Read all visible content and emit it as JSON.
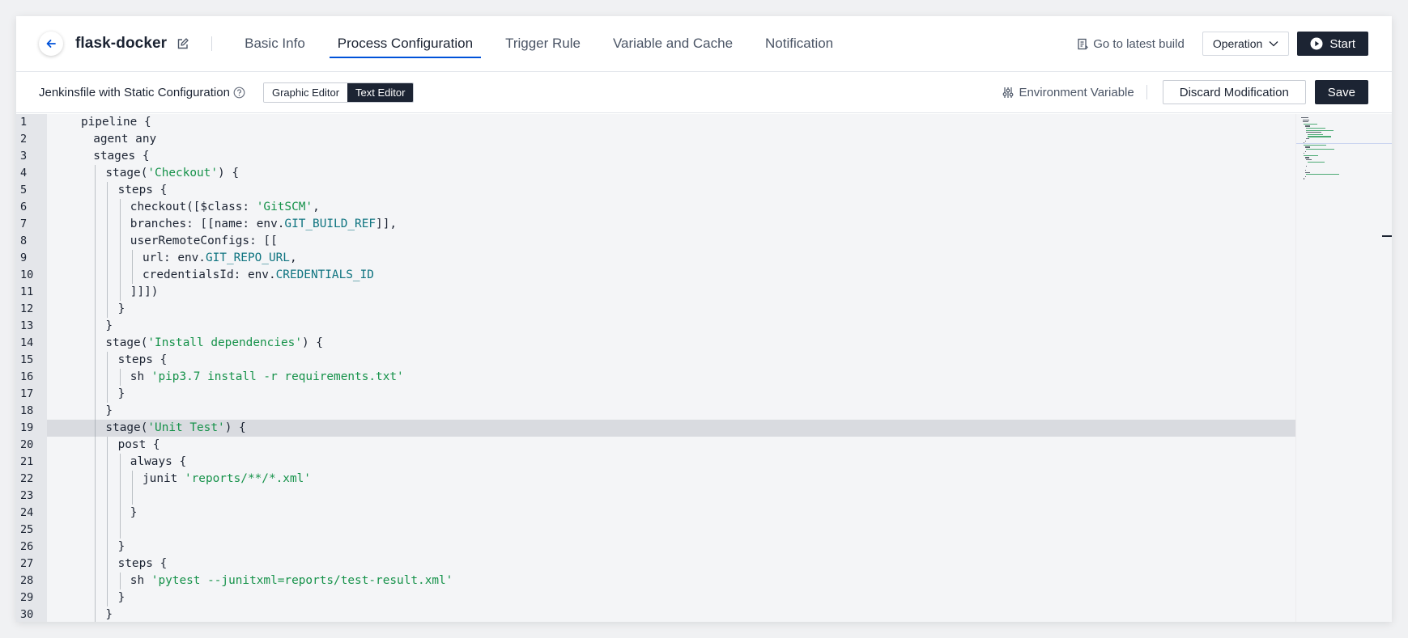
{
  "header": {
    "project_name": "flask-docker",
    "tabs": [
      {
        "label": "Basic Info",
        "active": false
      },
      {
        "label": "Process Configuration",
        "active": true
      },
      {
        "label": "Trigger Rule",
        "active": false
      },
      {
        "label": "Variable and Cache",
        "active": false
      },
      {
        "label": "Notification",
        "active": false
      }
    ],
    "latest_build_label": "Go to latest build",
    "operation_label": "Operation",
    "start_label": "Start"
  },
  "toolbar": {
    "config_label": "Jenkinsfile with Static Configuration",
    "graphic_editor_label": "Graphic Editor",
    "text_editor_label": "Text Editor",
    "env_variable_label": "Environment Variable",
    "discard_label": "Discard Modification",
    "save_label": "Save"
  },
  "editor": {
    "highlighted_line": 19,
    "lines": [
      {
        "n": "1",
        "indent": 0,
        "tokens": [
          [
            "t",
            "pipeline {"
          ]
        ]
      },
      {
        "n": "2",
        "indent": 1,
        "tokens": [
          [
            "t",
            "agent any"
          ]
        ]
      },
      {
        "n": "3",
        "indent": 1,
        "tokens": [
          [
            "t",
            "stages {"
          ]
        ]
      },
      {
        "n": "4",
        "indent": 2,
        "tokens": [
          [
            "t",
            "stage("
          ],
          [
            "s",
            "'Checkout'"
          ],
          [
            "t",
            ") {"
          ]
        ]
      },
      {
        "n": "5",
        "indent": 3,
        "tokens": [
          [
            "t",
            "steps {"
          ]
        ]
      },
      {
        "n": "6",
        "indent": 4,
        "tokens": [
          [
            "t",
            "checkout([$class: "
          ],
          [
            "s",
            "'GitSCM'"
          ],
          [
            "t",
            ","
          ]
        ]
      },
      {
        "n": "7",
        "indent": 4,
        "tokens": [
          [
            "t",
            "branches: [[name: env."
          ],
          [
            "p",
            "GIT_BUILD_REF"
          ],
          [
            "t",
            "]],"
          ]
        ]
      },
      {
        "n": "8",
        "indent": 4,
        "tokens": [
          [
            "t",
            "userRemoteConfigs: [["
          ]
        ]
      },
      {
        "n": "9",
        "indent": 5,
        "tokens": [
          [
            "t",
            "url: env."
          ],
          [
            "p",
            "GIT_REPO_URL"
          ],
          [
            "t",
            ","
          ]
        ]
      },
      {
        "n": "10",
        "indent": 5,
        "tokens": [
          [
            "t",
            "credentialsId: env."
          ],
          [
            "p",
            "CREDENTIALS_ID"
          ]
        ]
      },
      {
        "n": "11",
        "indent": 4,
        "tokens": [
          [
            "t",
            "]]])"
          ]
        ]
      },
      {
        "n": "12",
        "indent": 3,
        "tokens": [
          [
            "t",
            "}"
          ]
        ]
      },
      {
        "n": "13",
        "indent": 2,
        "tokens": [
          [
            "t",
            "}"
          ]
        ]
      },
      {
        "n": "14",
        "indent": 2,
        "tokens": [
          [
            "t",
            "stage("
          ],
          [
            "s",
            "'Install dependencies'"
          ],
          [
            "t",
            ") {"
          ]
        ]
      },
      {
        "n": "15",
        "indent": 3,
        "tokens": [
          [
            "t",
            "steps {"
          ]
        ]
      },
      {
        "n": "16",
        "indent": 4,
        "tokens": [
          [
            "t",
            "sh "
          ],
          [
            "s",
            "'pip3.7 install -r requirements.txt'"
          ]
        ]
      },
      {
        "n": "17",
        "indent": 3,
        "tokens": [
          [
            "t",
            "}"
          ]
        ]
      },
      {
        "n": "18",
        "indent": 2,
        "tokens": [
          [
            "t",
            "}"
          ]
        ]
      },
      {
        "n": "19",
        "indent": 2,
        "tokens": [
          [
            "t",
            "stage("
          ],
          [
            "s",
            "'Unit Test'"
          ],
          [
            "t",
            ") {"
          ]
        ]
      },
      {
        "n": "20",
        "indent": 3,
        "tokens": [
          [
            "t",
            "post {"
          ]
        ]
      },
      {
        "n": "21",
        "indent": 4,
        "tokens": [
          [
            "t",
            "always {"
          ]
        ]
      },
      {
        "n": "22",
        "indent": 5,
        "tokens": [
          [
            "t",
            "junit "
          ],
          [
            "s",
            "'reports/**/*.xml'"
          ]
        ]
      },
      {
        "n": "23",
        "indent": 5,
        "tokens": []
      },
      {
        "n": "24",
        "indent": 4,
        "tokens": [
          [
            "t",
            "}"
          ]
        ]
      },
      {
        "n": "25",
        "indent": 4,
        "tokens": []
      },
      {
        "n": "26",
        "indent": 3,
        "tokens": [
          [
            "t",
            "}"
          ]
        ]
      },
      {
        "n": "27",
        "indent": 3,
        "tokens": [
          [
            "t",
            "steps {"
          ]
        ]
      },
      {
        "n": "28",
        "indent": 4,
        "tokens": [
          [
            "t",
            "sh "
          ],
          [
            "s",
            "'pytest --junitxml=reports/test-result.xml'"
          ]
        ]
      },
      {
        "n": "29",
        "indent": 3,
        "tokens": [
          [
            "t",
            "}"
          ]
        ]
      },
      {
        "n": "30",
        "indent": 2,
        "tokens": [
          [
            "t",
            "}"
          ]
        ]
      }
    ]
  },
  "colors": {
    "accent": "#0052d9",
    "dark_button": "#1c2433",
    "string": "#16924a",
    "property": "#0f7480"
  },
  "icons": {
    "back": "arrow-left-icon",
    "edit": "edit-icon",
    "latest_build": "document-icon",
    "dropdown": "chevron-down-icon",
    "start": "play-circle-icon",
    "help": "question-circle-icon",
    "env": "sliders-icon"
  }
}
